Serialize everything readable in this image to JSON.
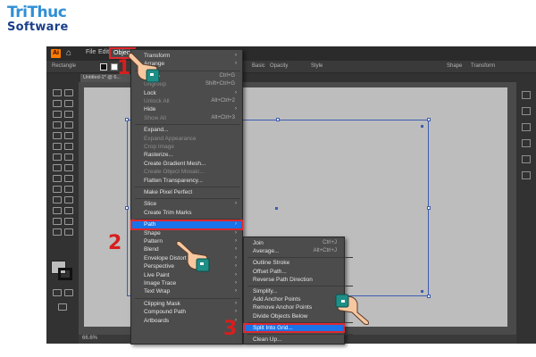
{
  "brand": {
    "line1": "TriThuc",
    "line2": "Software"
  },
  "menubar": {
    "file": "File",
    "edit": "Edit",
    "object": "Object"
  },
  "control_bar": {
    "mode": "Rectangle",
    "opacity_label": "Opacity",
    "style_label": "Style",
    "shape_label": "Shape",
    "transform_label": "Transform",
    "basic": "Basic"
  },
  "document_tab": "Untitled-1* @ 6...",
  "status": {
    "zoom": "66.6%"
  },
  "object_menu": [
    {
      "label": "Transform",
      "arrow": true
    },
    {
      "label": "Arrange",
      "arrow": true
    },
    {
      "sep": true
    },
    {
      "label": "Group",
      "shortcut": "Ctrl+G"
    },
    {
      "label": "Ungroup",
      "shortcut": "Shift+Ctrl+G",
      "disabled": true
    },
    {
      "label": "Lock",
      "arrow": true
    },
    {
      "label": "Unlock All",
      "shortcut": "Alt+Ctrl+2",
      "disabled": true
    },
    {
      "label": "Hide",
      "arrow": true
    },
    {
      "label": "Show All",
      "shortcut": "Alt+Ctrl+3",
      "disabled": true
    },
    {
      "sep": true
    },
    {
      "label": "Expand..."
    },
    {
      "label": "Expand Appearance",
      "disabled": true
    },
    {
      "label": "Crop Image",
      "disabled": true
    },
    {
      "label": "Rasterize..."
    },
    {
      "label": "Create Gradient Mesh..."
    },
    {
      "label": "Create Object Mosaic...",
      "disabled": true
    },
    {
      "label": "Flatten Transparency..."
    },
    {
      "sep": true
    },
    {
      "label": "Make Pixel Perfect"
    },
    {
      "sep": true
    },
    {
      "label": "Slice",
      "arrow": true
    },
    {
      "label": "Create Trim Marks"
    },
    {
      "sep": true
    },
    {
      "label": "Path",
      "arrow": true,
      "highlight": true
    },
    {
      "label": "Shape",
      "arrow": true
    },
    {
      "label": "Pattern",
      "arrow": true
    },
    {
      "label": "Blend",
      "arrow": true
    },
    {
      "label": "Envelope Distort",
      "arrow": true
    },
    {
      "label": "Perspective",
      "arrow": true
    },
    {
      "label": "Live Paint",
      "arrow": true
    },
    {
      "label": "Image Trace",
      "arrow": true
    },
    {
      "label": "Text Wrap",
      "arrow": true
    },
    {
      "sep": true
    },
    {
      "label": "Clipping Mask",
      "arrow": true
    },
    {
      "label": "Compound Path",
      "arrow": true
    },
    {
      "label": "Artboards",
      "arrow": true
    }
  ],
  "path_menu": [
    {
      "label": "Join",
      "shortcut": "Ctrl+J"
    },
    {
      "label": "Average...",
      "shortcut": "Alt+Ctrl+J"
    },
    {
      "sep": true
    },
    {
      "label": "Outline Stroke"
    },
    {
      "label": "Offset Path..."
    },
    {
      "label": "Reverse Path Direction"
    },
    {
      "sep": true
    },
    {
      "label": "Simplify..."
    },
    {
      "label": "Add Anchor Points"
    },
    {
      "label": "Remove Anchor Points"
    },
    {
      "label": "Divide Objects Below"
    },
    {
      "sep": true
    },
    {
      "label": "Split Into Grid...",
      "highlight": true
    },
    {
      "sep": true
    },
    {
      "label": "Clean Up..."
    }
  ],
  "steps": {
    "one": "1",
    "two": "2",
    "three": "3"
  },
  "colors": {
    "highlight": "#1a73e8",
    "annotation": "#d81e1e",
    "brand_blue": "#2f8fd6"
  }
}
